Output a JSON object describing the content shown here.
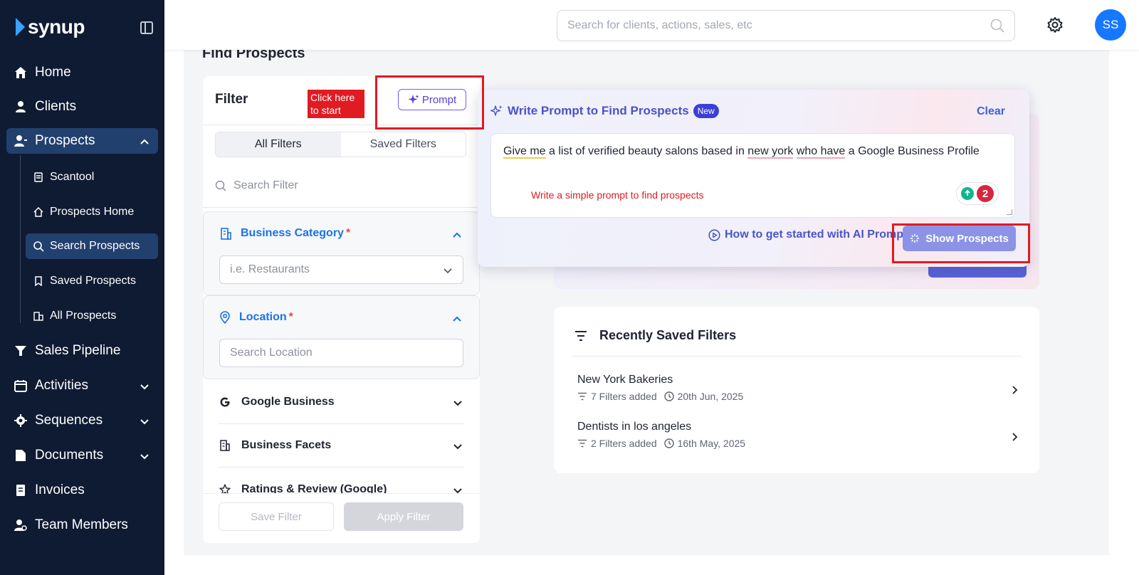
{
  "brand": {
    "name": "synup"
  },
  "sidebar": {
    "items": [
      {
        "label": "Home",
        "icon": "home-icon"
      },
      {
        "label": "Clients",
        "icon": "user-icon"
      },
      {
        "label": "Prospects",
        "icon": "prospects-icon"
      },
      {
        "label": "Sales Pipeline",
        "icon": "funnel-icon"
      },
      {
        "label": "Activities",
        "icon": "calendar-icon"
      },
      {
        "label": "Sequences",
        "icon": "cog-icon"
      },
      {
        "label": "Documents",
        "icon": "document-icon"
      },
      {
        "label": "Invoices",
        "icon": "invoice-icon"
      },
      {
        "label": "Team Members",
        "icon": "team-icon"
      }
    ],
    "sub_items": [
      {
        "label": "Scantool",
        "icon": "scan-icon"
      },
      {
        "label": "Prospects Home",
        "icon": "home-outline-icon"
      },
      {
        "label": "Search Prospects",
        "icon": "search-icon"
      },
      {
        "label": "Saved Prospects",
        "icon": "bookmark-icon"
      },
      {
        "label": "All Prospects",
        "icon": "buildings-icon"
      }
    ]
  },
  "topbar": {
    "search_placeholder": "Search for clients, actions, sales, etc",
    "avatar_initials": "SS"
  },
  "page": {
    "title": "Find Prospects"
  },
  "filter": {
    "title": "Filter",
    "prompt_button": "Prompt",
    "tabs": [
      "All Filters",
      "Saved Filters"
    ],
    "search_placeholder": "Search Filter",
    "business_category": {
      "label": "Business Category",
      "required": "*",
      "placeholder": "i.e. Restaurants"
    },
    "location": {
      "label": "Location",
      "required": "*",
      "placeholder": "Search Location"
    },
    "sections": [
      "Google Business",
      "Business Facets",
      "Ratings & Review (Google)"
    ],
    "save_button": "Save Filter",
    "apply_button": "Apply Filter"
  },
  "prompt_panel": {
    "title": "Write Prompt to Find Prospects",
    "badge": "New",
    "clear": "Clear",
    "prompt_parts": [
      "Give me",
      " a list of verified beauty salons based in ",
      "new york",
      " ",
      "who have",
      " a Google Business Profile"
    ],
    "grammar_count": "2",
    "howto": "How to get started with AI Prompt",
    "show_button": "Show Prospects"
  },
  "recent": {
    "title": "Recently Saved Filters",
    "rows": [
      {
        "name": "New York Bakeries",
        "filters": "7 Filters added",
        "date": "20th Jun, 2025"
      },
      {
        "name": "Dentists in los angeles",
        "filters": "2 Filters added",
        "date": "16th May, 2025"
      }
    ]
  },
  "annotations": {
    "click_here": "Click here to start",
    "hint": "Write a simple prompt to find prospects"
  },
  "colors": {
    "sidebar_bg": "#0f1b33",
    "accent": "#1a73e8",
    "annotation_red": "#e01b22",
    "prompt_purple": "#4a52c9"
  }
}
